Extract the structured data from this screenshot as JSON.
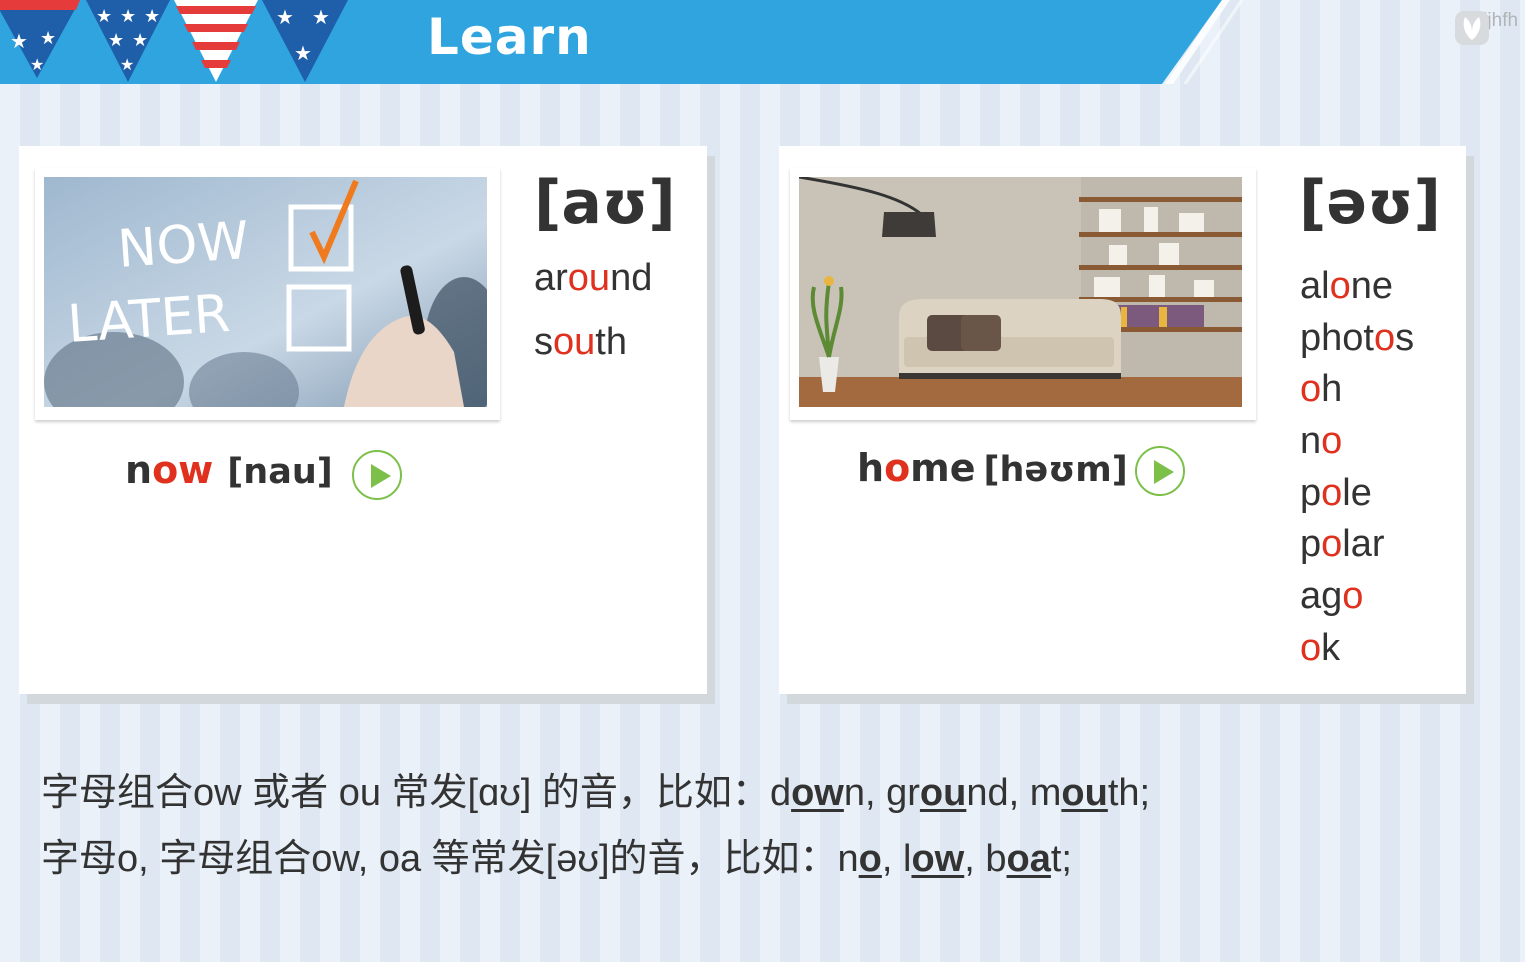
{
  "header": {
    "title": "Learn",
    "logo_text": "njllljhfh",
    "colors": {
      "banner": "#2fa4df",
      "flag_red": "#e63b3b",
      "flag_blue": "#1f5ea8"
    }
  },
  "cards": [
    {
      "image": "now-later-checklist-photo",
      "phonetic": "[aʊ]",
      "words": [
        {
          "pre": "ar",
          "hl": "ou",
          "post": "nd"
        },
        {
          "pre": "s",
          "hl": "ou",
          "post": "th"
        }
      ],
      "keyword": {
        "pre": "n",
        "hl": "ow",
        "post": "",
        "ipa": "[nau]"
      },
      "play_icon": "play-icon"
    },
    {
      "image": "living-room-sofa-photo",
      "phonetic": "[əʊ]",
      "words": [
        {
          "pre": "al",
          "hl": "o",
          "post": "ne"
        },
        {
          "pre": "phot",
          "hl": "o",
          "post": "s"
        },
        {
          "pre": "",
          "hl": "o",
          "post": "h"
        },
        {
          "pre": "n",
          "hl": "o",
          "post": ""
        },
        {
          "pre": "p",
          "hl": "o",
          "post": "le"
        },
        {
          "pre": "p",
          "hl": "o",
          "post": "lar"
        },
        {
          "pre": "ag",
          "hl": "o",
          "post": ""
        },
        {
          "pre": "",
          "hl": "o",
          "post": "k"
        }
      ],
      "keyword": {
        "pre": "h",
        "hl": "o",
        "post": "me",
        "ipa": "[həʊm]"
      },
      "play_icon": "play-icon"
    }
  ],
  "notes": [
    {
      "intro": "字母组合ow 或者 ou 常发[ɑʊ] 的音，比如：",
      "examples": [
        {
          "pre": "d",
          "u": "ow",
          "post": "n, "
        },
        {
          "pre": "gr",
          "u": "ou",
          "post": "nd, "
        },
        {
          "pre": "m",
          "u": "ou",
          "post": "th;"
        }
      ]
    },
    {
      "intro": "字母o, 字母组合ow, oa 等常发[əʊ]的音，比如：",
      "examples": [
        {
          "pre": "n",
          "u": "o",
          "post": ", "
        },
        {
          "pre": "l",
          "u": "ow",
          "post": ", "
        },
        {
          "pre": "b",
          "u": "oa",
          "post": "t;"
        }
      ]
    }
  ]
}
